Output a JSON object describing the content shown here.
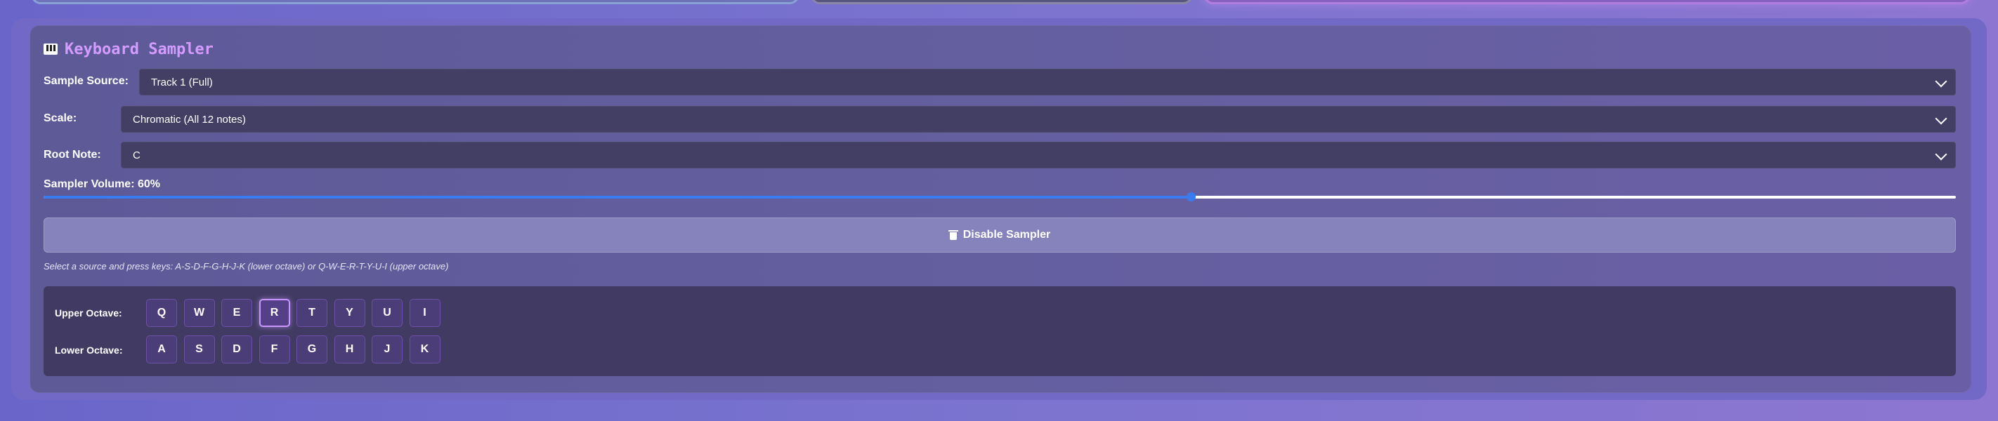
{
  "sampler": {
    "title": "Keyboard Sampler",
    "source_label": "Sample Source:",
    "source_value": "Track 1 (Full)",
    "scale_label": "Scale:",
    "scale_value": "Chromatic (All 12 notes)",
    "root_label": "Root Note:",
    "root_value": "C",
    "volume_label": "Sampler Volume: 60%",
    "volume_fraction": 0.6,
    "disable_label": "Disable Sampler",
    "help_text": "Select a source and press keys: A-S-D-F-G-H-J-K (lower octave) or Q-W-E-R-T-Y-U-I (upper octave)"
  },
  "keyboard": {
    "upper_label": "Upper Octave:",
    "lower_label": "Lower Octave:",
    "upper_keys": [
      "Q",
      "W",
      "E",
      "R",
      "T",
      "Y",
      "U",
      "I"
    ],
    "lower_keys": [
      "A",
      "S",
      "D",
      "F",
      "G",
      "H",
      "J",
      "K"
    ],
    "active_key": "R"
  },
  "colors": {
    "accent": "#3b7bf0",
    "title": "#d59cff",
    "key_active_border": "#c995ff"
  }
}
